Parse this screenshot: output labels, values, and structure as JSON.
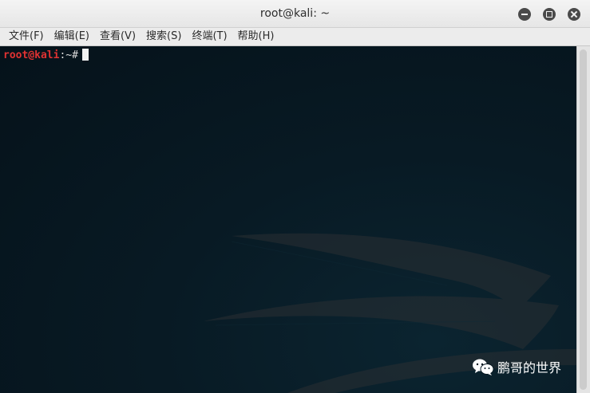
{
  "window": {
    "title": "root@kali: ~"
  },
  "menu": {
    "items": [
      {
        "label": "文件(F)"
      },
      {
        "label": "编辑(E)"
      },
      {
        "label": "查看(V)"
      },
      {
        "label": "搜索(S)"
      },
      {
        "label": "终端(T)"
      },
      {
        "label": "帮助(H)"
      }
    ]
  },
  "terminal": {
    "user_host": "root@kali",
    "path_suffix": ":~#"
  },
  "watermark": {
    "text": "鹏哥的世界",
    "icon": "wechat-icon"
  },
  "colors": {
    "prompt_user": "#e03232",
    "terminal_bg": "#061620"
  }
}
